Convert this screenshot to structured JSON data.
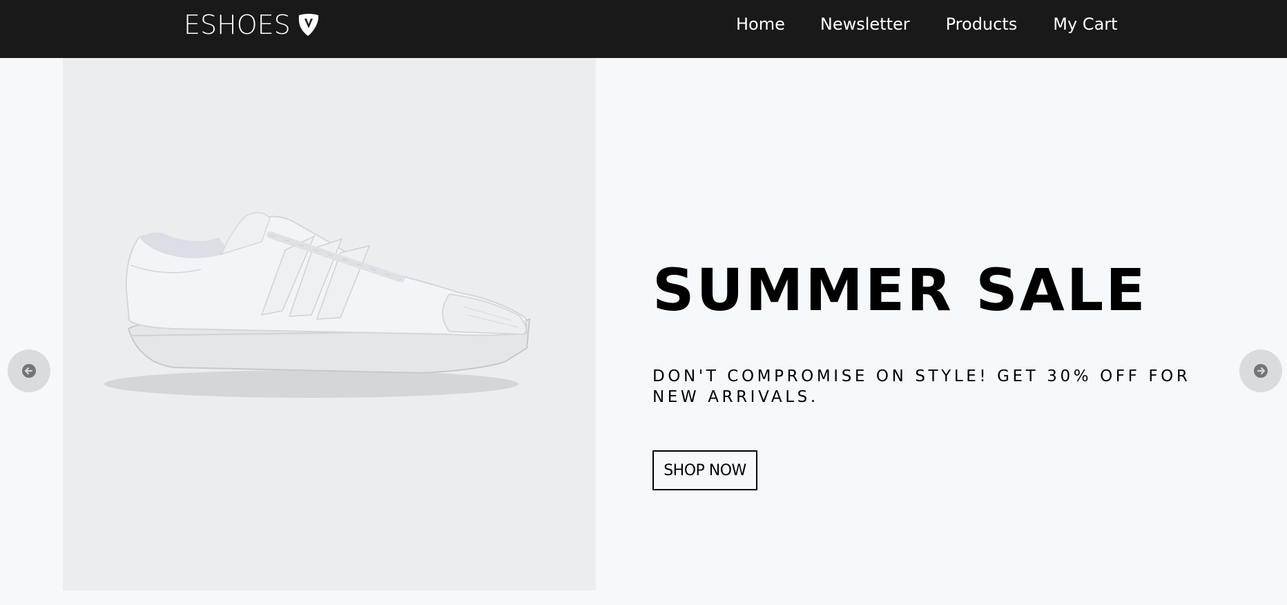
{
  "header": {
    "logo_text": "ESHOES",
    "logo_icon": "shield-v-icon",
    "nav": [
      {
        "label": "Home"
      },
      {
        "label": "Newsletter"
      },
      {
        "label": "Products"
      },
      {
        "label": "My Cart"
      }
    ]
  },
  "hero": {
    "image": "white-sneaker-image",
    "title": "SUMMER SALE",
    "description": "DON'T COMPROMISE ON STYLE! GET 30% OFF FOR NEW ARRIVALS.",
    "button_label": "SHOP NOW",
    "prev_icon": "arrow-left-icon",
    "next_icon": "arrow-right-icon"
  },
  "colors": {
    "navbar_bg": "#1a191a",
    "page_bg": "#f5f9fb",
    "image_bg": "#eaeeef",
    "arrow_bg": "#d9dcdd",
    "text": "#000000"
  }
}
